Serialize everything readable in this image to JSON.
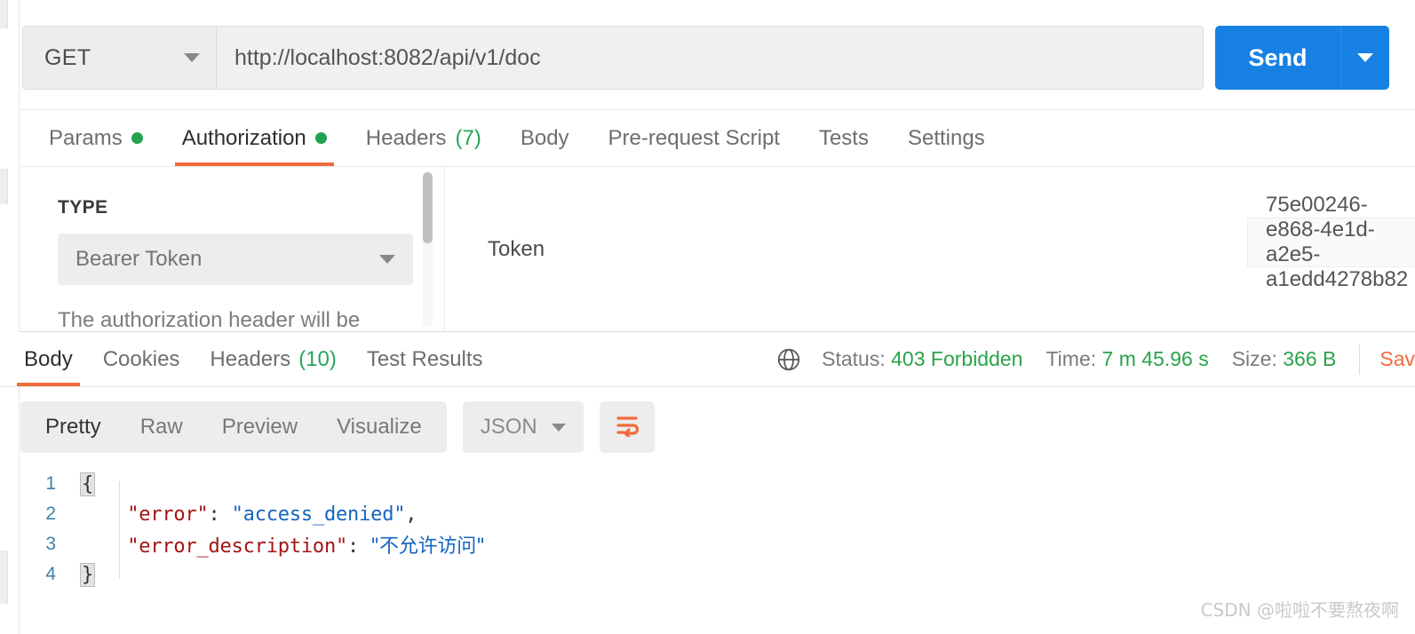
{
  "request": {
    "method": "GET",
    "url": "http://localhost:8082/api/v1/doc",
    "send_label": "Send",
    "tabs": [
      {
        "label": "Params",
        "indicator": "dot",
        "active": false
      },
      {
        "label": "Authorization",
        "indicator": "dot",
        "active": true
      },
      {
        "label": "Headers",
        "count": "(7)",
        "active": false
      },
      {
        "label": "Body",
        "active": false
      },
      {
        "label": "Pre-request Script",
        "active": false
      },
      {
        "label": "Tests",
        "active": false
      },
      {
        "label": "Settings",
        "active": false
      }
    ]
  },
  "authorization": {
    "type_label": "TYPE",
    "type_value": "Bearer Token",
    "help_text": "The authorization header will be",
    "token_label": "Token",
    "token_value": "75e00246-e868-4e1d-a2e5-a1edd4278b82"
  },
  "response": {
    "tabs": [
      {
        "label": "Body",
        "active": true
      },
      {
        "label": "Cookies",
        "active": false
      },
      {
        "label": "Headers",
        "count": "(10)",
        "active": false
      },
      {
        "label": "Test Results",
        "active": false
      }
    ],
    "status_label": "Status:",
    "status_value": "403 Forbidden",
    "time_label": "Time:",
    "time_value": "7 m 45.96 s",
    "size_label": "Size:",
    "size_value": "366 B",
    "save_response": "Sav",
    "view_modes": [
      {
        "label": "Pretty",
        "active": true
      },
      {
        "label": "Raw",
        "active": false
      },
      {
        "label": "Preview",
        "active": false
      },
      {
        "label": "Visualize",
        "active": false
      }
    ],
    "format": "JSON",
    "body_lines": [
      {
        "n": "1",
        "open_brace": "{"
      },
      {
        "n": "2",
        "key": "\"error\"",
        "sep": ": ",
        "value": "\"access_denied\"",
        "tail": ","
      },
      {
        "n": "3",
        "key": "\"error_description\"",
        "sep": ": ",
        "value": "\"不允许访问\"",
        "tail": ""
      },
      {
        "n": "4",
        "close_brace": "}"
      }
    ]
  },
  "watermark": "CSDN @啦啦不要熬夜啊",
  "colors": {
    "accent_orange": "#f26b3a",
    "send_blue": "#1781e3",
    "status_green": "#2aa34a",
    "json_key": "#a31515",
    "json_string": "#1565c0"
  }
}
